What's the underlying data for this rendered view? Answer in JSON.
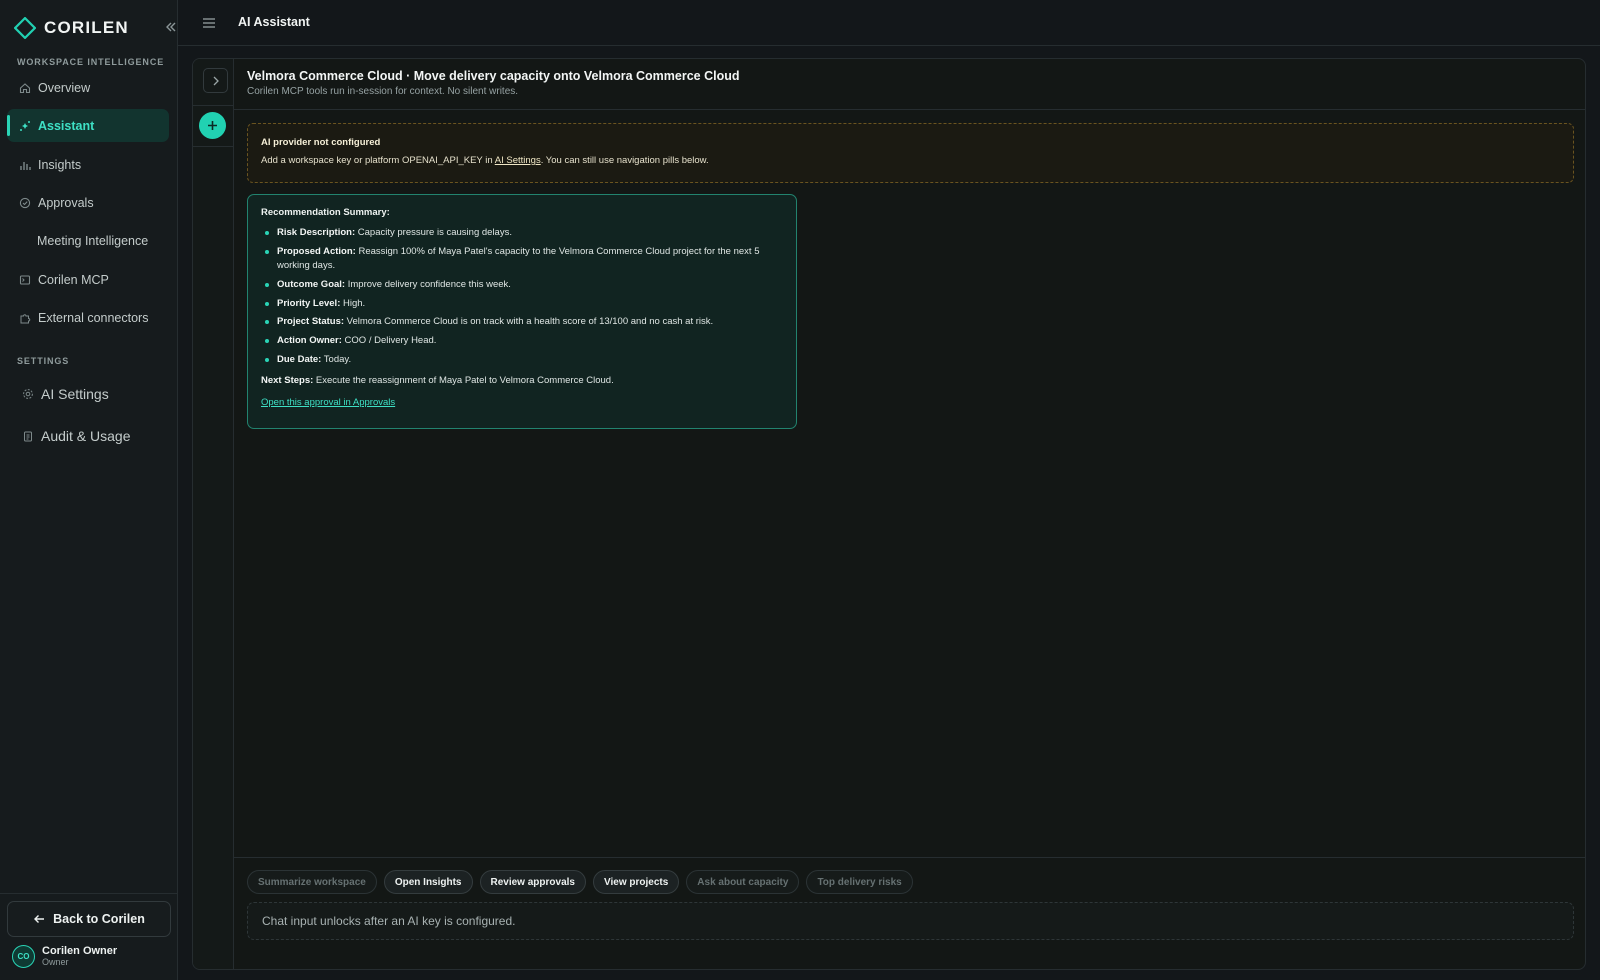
{
  "app": {
    "brand": "CORILEN",
    "accent_color": "#21d1b2",
    "page_title": "AI Assistant"
  },
  "sidebar": {
    "section_workspace": "WORKSPACE INTELLIGENCE",
    "items": [
      {
        "label": "Overview",
        "icon": "home-icon"
      },
      {
        "label": "Assistant",
        "icon": "sparkle-icon",
        "active": true
      },
      {
        "label": "Insights",
        "icon": "bar-chart-icon"
      },
      {
        "label": "Approvals",
        "icon": "check-circle-icon"
      },
      {
        "label": "Meeting Intelligence",
        "icon": ""
      },
      {
        "label": "Corilen MCP",
        "icon": "terminal-icon"
      },
      {
        "label": "External connectors",
        "icon": "puzzle-icon"
      }
    ],
    "section_settings": "SETTINGS",
    "settings_items": [
      {
        "label": "AI Settings",
        "icon": "gear-icon"
      },
      {
        "label": "Audit & Usage",
        "icon": "clipboard-icon"
      }
    ],
    "back_label": "Back to Corilen",
    "user": {
      "initials": "CO",
      "name": "Corilen Owner",
      "role": "Owner"
    }
  },
  "chat": {
    "title": "Velmora Commerce Cloud · Move delivery capacity onto Velmora Commerce Cloud",
    "subtitle": "Corilen MCP tools run in-session for context. No silent writes."
  },
  "warning": {
    "title": "AI provider not configured",
    "text_before": "Add a workspace key or platform OPENAI_API_KEY in ",
    "link": "AI Settings",
    "text_after": ". You can still use navigation pills below."
  },
  "recommendation": {
    "heading": "Recommendation Summary:",
    "items": [
      {
        "key": "Risk Description:",
        "value": " Capacity pressure is causing delays."
      },
      {
        "key": "Proposed Action:",
        "value": " Reassign 100% of Maya Patel's capacity to the Velmora Commerce Cloud project for the next 5 working days."
      },
      {
        "key": "Outcome Goal:",
        "value": " Improve delivery confidence this week."
      },
      {
        "key": "Priority Level:",
        "value": " High."
      },
      {
        "key": "Project Status:",
        "value": " Velmora Commerce Cloud is on track with a health score of 13/100 and no cash at risk."
      },
      {
        "key": "Action Owner:",
        "value": " COO / Delivery Head."
      },
      {
        "key": "Due Date:",
        "value": " Today."
      }
    ],
    "next_key": "Next Steps:",
    "next_value": " Execute the reassignment of Maya Patel to Velmora Commerce Cloud.",
    "link": "Open this approval in Approvals"
  },
  "pills": [
    {
      "label": "Summarize workspace",
      "enabled": false
    },
    {
      "label": "Open Insights",
      "enabled": true
    },
    {
      "label": "Review approvals",
      "enabled": true
    },
    {
      "label": "View projects",
      "enabled": true
    },
    {
      "label": "Ask about capacity",
      "enabled": false
    },
    {
      "label": "Top delivery risks",
      "enabled": false
    }
  ],
  "input": {
    "placeholder": "Chat input unlocks after an AI key is configured."
  }
}
